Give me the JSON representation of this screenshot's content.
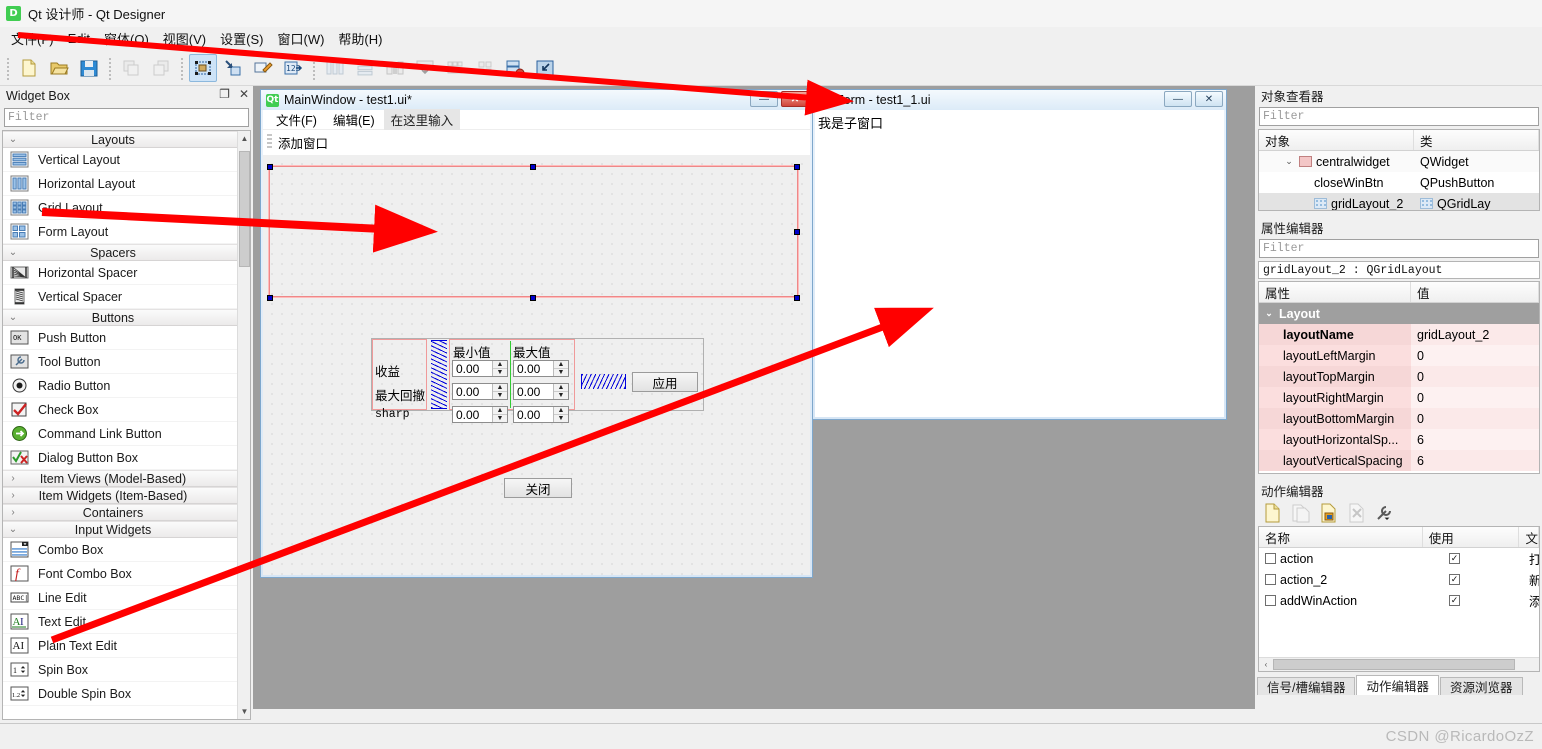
{
  "window": {
    "title": "Qt 设计师 - Qt Designer",
    "logo": "qt-logo"
  },
  "menubar": {
    "items": [
      {
        "label": "文件(F)"
      },
      {
        "label": "Edit"
      },
      {
        "label": "窗体(O)"
      },
      {
        "label": "视图(V)"
      },
      {
        "label": "设置(S)"
      },
      {
        "label": "窗口(W)"
      },
      {
        "label": "帮助(H)"
      }
    ]
  },
  "toolbar": {
    "groups": [
      {
        "buttons": [
          {
            "name": "new-form-icon",
            "label": "新建"
          },
          {
            "name": "open-form-icon",
            "label": "打开"
          },
          {
            "name": "save-form-icon",
            "label": "保存"
          }
        ]
      },
      {
        "buttons": [
          {
            "name": "undo-icon",
            "label": "撤销"
          },
          {
            "name": "redo-icon",
            "label": "重做"
          }
        ]
      },
      {
        "buttons": [
          {
            "name": "edit-widgets-icon",
            "label": "编辑控件"
          },
          {
            "name": "edit-signals-slots-icon",
            "label": "编辑信号/槽"
          },
          {
            "name": "edit-buddies-icon",
            "label": "编辑伙伴"
          },
          {
            "name": "edit-tab-order-icon",
            "label": "编辑Tab顺序"
          }
        ]
      },
      {
        "buttons": [
          {
            "name": "layout-horizontally-icon",
            "label": "水平布局"
          },
          {
            "name": "layout-vertically-icon",
            "label": "垂直布局"
          },
          {
            "name": "layout-in-splitter-icon",
            "label": "拆分器布局"
          },
          {
            "name": "layout-form-icon",
            "label": "窗体布局"
          },
          {
            "name": "layout-grid-icon",
            "label": "栅格布局"
          },
          {
            "name": "layout-break-icon",
            "label": "打散布局"
          },
          {
            "name": "adjust-size-icon",
            "label": "调整大小"
          },
          {
            "name": "preview-icon",
            "label": "预览"
          }
        ]
      }
    ]
  },
  "widget_box": {
    "title": "Widget Box",
    "dock_float_label": "❐",
    "dock_close_label": "✕",
    "filter_placeholder": "Filter",
    "categories": [
      {
        "label": "Layouts",
        "expanded": true,
        "chevron": "⌄",
        "items": [
          {
            "label": "Vertical Layout",
            "icon": "vertical-layout-icon"
          },
          {
            "label": "Horizontal Layout",
            "icon": "horizontal-layout-icon"
          },
          {
            "label": "Grid Layout",
            "icon": "grid-layout-icon"
          },
          {
            "label": "Form Layout",
            "icon": "form-layout-icon"
          }
        ]
      },
      {
        "label": "Spacers",
        "expanded": true,
        "chevron": "⌄",
        "items": [
          {
            "label": "Horizontal Spacer",
            "icon": "horizontal-spacer-icon"
          },
          {
            "label": "Vertical Spacer",
            "icon": "vertical-spacer-icon"
          }
        ]
      },
      {
        "label": "Buttons",
        "expanded": true,
        "chevron": "⌄",
        "items": [
          {
            "label": "Push Button",
            "icon": "push-button-icon"
          },
          {
            "label": "Tool Button",
            "icon": "tool-button-icon"
          },
          {
            "label": "Radio Button",
            "icon": "radio-button-icon"
          },
          {
            "label": "Check Box",
            "icon": "check-box-icon"
          },
          {
            "label": "Command Link Button",
            "icon": "command-link-button-icon"
          },
          {
            "label": "Dialog Button Box",
            "icon": "dialog-button-box-icon"
          }
        ]
      },
      {
        "label": "Item Views (Model-Based)",
        "expanded": false,
        "chevron": "›",
        "items": []
      },
      {
        "label": "Item Widgets (Item-Based)",
        "expanded": false,
        "chevron": "›",
        "items": []
      },
      {
        "label": "Containers",
        "expanded": false,
        "chevron": "›",
        "items": []
      },
      {
        "label": "Input Widgets",
        "expanded": true,
        "chevron": "⌄",
        "items": [
          {
            "label": "Combo Box",
            "icon": "combo-box-icon"
          },
          {
            "label": "Font Combo Box",
            "icon": "font-combo-box-icon"
          },
          {
            "label": "Line Edit",
            "icon": "line-edit-icon"
          },
          {
            "label": "Text Edit",
            "icon": "text-edit-icon"
          },
          {
            "label": "Plain Text Edit",
            "icon": "plain-text-edit-icon"
          },
          {
            "label": "Spin Box",
            "icon": "spin-box-icon"
          },
          {
            "label": "Double Spin Box",
            "icon": "double-spin-box-icon"
          }
        ]
      }
    ]
  },
  "mdi": {
    "mainwindow": {
      "title": "MainWindow - test1.ui*",
      "minimize_label": "—",
      "close_label": "✕",
      "menus": [
        {
          "label": "文件(F)",
          "placeholder": false
        },
        {
          "label": "编辑(E)",
          "placeholder": false
        },
        {
          "label": "在这里输入",
          "placeholder": true
        }
      ],
      "toolbar_action": "添加窗口",
      "form": {
        "row_labels": [
          "收益",
          "最大回撤",
          "sharp"
        ],
        "col_headers": [
          "最小值",
          "最大值"
        ],
        "spin_value": "0.00",
        "apply_button": "应用",
        "close_button": "关闭"
      }
    },
    "form_window": {
      "title": "Form - test1_1.ui",
      "minimize_label": "—",
      "close_label": "✕",
      "body_text": "我是子窗口"
    }
  },
  "object_inspector": {
    "title": "对象查看器",
    "filter_placeholder": "Filter",
    "columns": [
      "对象",
      "类"
    ],
    "rows": [
      {
        "name": "centralwidget",
        "class": "QWidget",
        "indent": 1,
        "chevron": "⌄",
        "icon": "widget-icon",
        "selected": false
      },
      {
        "name": "closeWinBtn",
        "class": "QPushButton",
        "indent": 2,
        "chevron": "",
        "icon": "",
        "selected": false
      },
      {
        "name": "gridLayout_2",
        "class": "QGridLay",
        "indent": 2,
        "chevron": "",
        "icon": "grid-layout-icon",
        "selected": true
      }
    ]
  },
  "property_editor": {
    "title": "属性编辑器",
    "filter_placeholder": "Filter",
    "object_header": "gridLayout_2 : QGridLayout",
    "columns": [
      "属性",
      "值"
    ],
    "group": {
      "label": "Layout",
      "chevron": "⌄"
    },
    "rows": [
      {
        "key": "layoutName",
        "value": "gridLayout_2"
      },
      {
        "key": "layoutLeftMargin",
        "value": "0"
      },
      {
        "key": "layoutTopMargin",
        "value": "0"
      },
      {
        "key": "layoutRightMargin",
        "value": "0"
      },
      {
        "key": "layoutBottomMargin",
        "value": "0"
      },
      {
        "key": "layoutHorizontalSp...",
        "value": "6"
      },
      {
        "key": "layoutVerticalSpacing",
        "value": "6"
      }
    ]
  },
  "action_editor": {
    "title": "动作编辑器",
    "toolbar": [
      {
        "name": "new-action-icon",
        "label": "新建",
        "disabled": false
      },
      {
        "name": "copy-action-icon",
        "label": "复制",
        "disabled": true
      },
      {
        "name": "edit-action-icon",
        "label": "编辑",
        "disabled": false
      },
      {
        "name": "delete-action-icon",
        "label": "删除",
        "disabled": true
      },
      {
        "name": "configure-action-icon",
        "label": "配置",
        "disabled": false
      }
    ],
    "columns": [
      "名称",
      "使用",
      "文"
    ],
    "rows": [
      {
        "name": "action",
        "used": true,
        "text": "打"
      },
      {
        "name": "action_2",
        "used": true,
        "text": "新"
      },
      {
        "name": "addWinAction",
        "used": true,
        "text": "添"
      }
    ],
    "scroll_left_label": "‹",
    "tabs": [
      {
        "label": "信号/槽编辑器",
        "active": false
      },
      {
        "label": "动作编辑器",
        "active": true
      },
      {
        "label": "资源浏览器",
        "active": false
      }
    ]
  },
  "watermark": "CSDN @RicardoOzZ",
  "colors": {
    "accent": "#41cd52",
    "arrow_red": "#ff0000",
    "selection_blue": "#0000cc",
    "property_pink": "#f6d7d7",
    "mdi_background": "#9e9e9e"
  }
}
